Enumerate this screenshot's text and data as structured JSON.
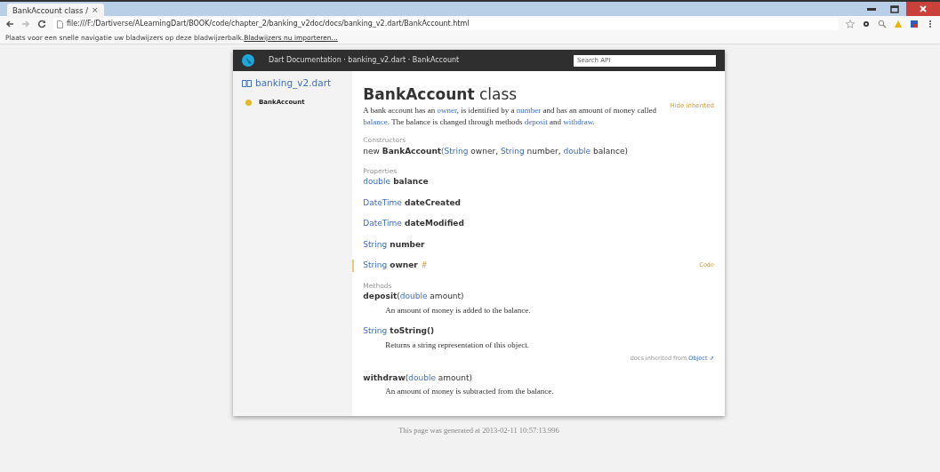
{
  "browser": {
    "tab_title": "BankAccount class / ",
    "tab_close": "×",
    "url": "file:///F:/Dartiverse/ALearningDart/BOOK/code/chapter_2/banking_v2doc/docs/banking_v2.dart/BankAccount.html",
    "bookmarks_text": "Plaats voor een snelle navigatie uw bladwijzers op deze bladwijzerbalk.",
    "bookmarks_link": "Bladwijzers nu importeren..."
  },
  "header": {
    "title": "Dart Documentation · banking_v2.dart · BankAccount",
    "search_placeholder": "Search API"
  },
  "sidebar": {
    "library": "banking_v2.dart",
    "items": [
      {
        "label": "BankAccount",
        "selected": true
      }
    ]
  },
  "main": {
    "title_name": "BankAccount",
    "title_suffix": "class",
    "hide_inherited": "Hide inherited",
    "description": [
      {
        "kind": "text",
        "text": "A bank account has an "
      },
      {
        "kind": "link",
        "text": "owner"
      },
      {
        "kind": "text",
        "text": ", is identified by a "
      },
      {
        "kind": "link",
        "text": "number"
      },
      {
        "kind": "text",
        "text": " and has an amount of money called "
      },
      {
        "kind": "link",
        "text": "balance"
      },
      {
        "kind": "text",
        "text": ". The balance is changed through methods "
      },
      {
        "kind": "link",
        "text": "deposit"
      },
      {
        "kind": "text",
        "text": " and "
      },
      {
        "kind": "link",
        "text": "withdraw"
      },
      {
        "kind": "text",
        "text": "."
      }
    ],
    "sections": [
      {
        "heading": "Constructors",
        "members": [
          {
            "highlighted": false,
            "signature": [
              {
                "kind": "text",
                "text": "new "
              },
              {
                "kind": "name",
                "text": "BankAccount"
              },
              {
                "kind": "link",
                "text": "("
              },
              {
                "kind": "link",
                "text": "String"
              },
              {
                "kind": "text",
                "text": " owner, "
              },
              {
                "kind": "link",
                "text": "String"
              },
              {
                "kind": "text",
                "text": " number, "
              },
              {
                "kind": "link",
                "text": "double"
              },
              {
                "kind": "text",
                "text": " balance)"
              }
            ]
          }
        ]
      },
      {
        "heading": "Properties",
        "members": [
          {
            "highlighted": false,
            "signature": [
              {
                "kind": "link",
                "text": "double"
              },
              {
                "kind": "name",
                "text": " balance"
              }
            ]
          },
          {
            "highlighted": false,
            "signature": [
              {
                "kind": "link",
                "text": "DateTime"
              },
              {
                "kind": "name",
                "text": " dateCreated"
              }
            ]
          },
          {
            "highlighted": false,
            "signature": [
              {
                "kind": "link",
                "text": "DateTime"
              },
              {
                "kind": "name",
                "text": " dateModified"
              }
            ]
          },
          {
            "highlighted": false,
            "signature": [
              {
                "kind": "link",
                "text": "String"
              },
              {
                "kind": "name",
                "text": " number"
              }
            ]
          },
          {
            "highlighted": true,
            "signature": [
              {
                "kind": "link",
                "text": "String"
              },
              {
                "kind": "name",
                "text": " owner"
              }
            ],
            "anchor": "#",
            "code_link": "Code"
          }
        ]
      },
      {
        "heading": "Methods",
        "members": [
          {
            "highlighted": false,
            "signature": [
              {
                "kind": "name",
                "text": "deposit"
              },
              {
                "kind": "text",
                "text": "("
              },
              {
                "kind": "link",
                "text": "double"
              },
              {
                "kind": "text",
                "text": " amount)"
              }
            ],
            "doc": "An amount of money is added to the balance."
          },
          {
            "highlighted": false,
            "signature": [
              {
                "kind": "link",
                "text": "String"
              },
              {
                "kind": "name",
                "text": " toString()"
              }
            ],
            "doc": "Returns a string representation of this object.",
            "inherited_text": "docs inherited from",
            "inherited_link": "Object ⇗"
          },
          {
            "highlighted": false,
            "signature": [
              {
                "kind": "name",
                "text": "withdraw"
              },
              {
                "kind": "text",
                "text": "("
              },
              {
                "kind": "link",
                "text": "double"
              },
              {
                "kind": "text",
                "text": " amount)"
              }
            ],
            "doc": "An amount of money is subtracted from the balance."
          }
        ]
      }
    ]
  },
  "footer": "This page was generated at 2013-02-11 10:57:13.996"
}
